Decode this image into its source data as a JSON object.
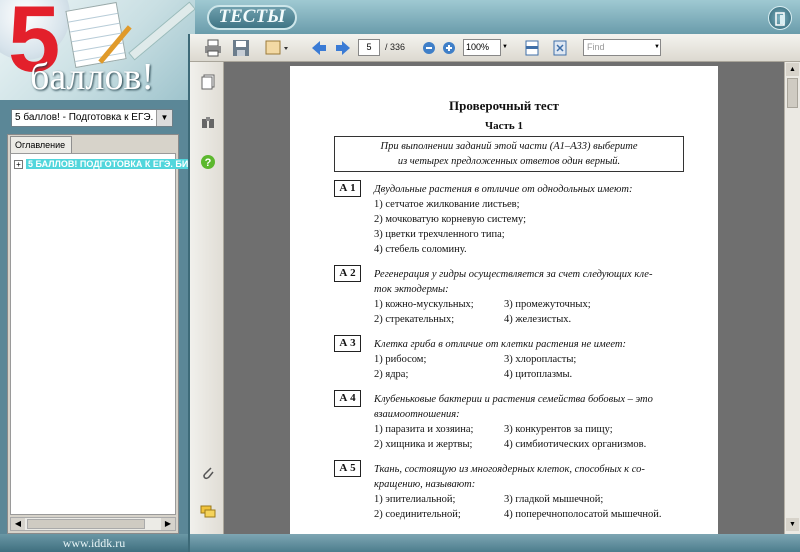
{
  "app": {
    "title": "ТЕСТЫ",
    "logo_number": "5",
    "logo_word": "баллов!",
    "site": "www.iddk.ru"
  },
  "left_panel": {
    "doc_select": "5 баллов! - Подготовка к ЕГЭ. Би",
    "tab_toc": "Оглавление",
    "toc_item": "5 БАЛЛОВ! ПОДГОТОВКА К ЕГЭ. БИ"
  },
  "toolbar": {
    "page_current": "5",
    "page_total": "/ 336",
    "zoom": "100%",
    "find_placeholder": "Find"
  },
  "document": {
    "title": "Проверочный тест",
    "part": "Часть 1",
    "instruction_line1": "При выполнении заданий этой части (А1–А33) выберите",
    "instruction_line2": "из четырех предложенных ответов один верный.",
    "questions": [
      {
        "num": "А 1",
        "text1": "Двудольные растения в отличие от однодольных имеют:",
        "text2": "",
        "options": [
          "1) сетчатое жилкование листьев;",
          "2) мочковатую корневую систему;",
          "3) цветки трехчленного типа;",
          "4) стебель соломину."
        ]
      },
      {
        "num": "А 2",
        "text1": "Регенерация у гидры осуществляется за счет следующих кле-",
        "text2": "ток эктодермы:",
        "options": [
          "1) кожно-мускульных;",
          "3) промежуточных;",
          "2) стрекательных;",
          "4) железистых."
        ]
      },
      {
        "num": "А 3",
        "text1": "Клетка гриба в отличие от клетки растения не имеет:",
        "text2": "",
        "options": [
          "1) рибосом;",
          "3) хлоропласты;",
          "2) ядра;",
          "4) цитоплазмы."
        ]
      },
      {
        "num": "А 4",
        "text1": "Клубеньковые бактерии и растения семейства бобовых – это",
        "text2": "взаимоотношения:",
        "options": [
          "1) паразита и хозяина;",
          "3) конкурентов за пищу;",
          "2) хищника и жертвы;",
          "4) симбиотических организмов."
        ]
      },
      {
        "num": "А 5",
        "text1": "Ткань, состоящую из многоядерных клеток, способных к со-",
        "text2": "кращению, называют:",
        "options": [
          "1) эпителиальной;",
          "3) гладкой мышечной;",
          "2) соединительной;",
          "4) поперечнополосатой мышечной."
        ]
      }
    ]
  },
  "colors": {
    "background": "#4f7f90",
    "accent_red": "#e3202b",
    "toc_highlight": "#52d6dc"
  }
}
